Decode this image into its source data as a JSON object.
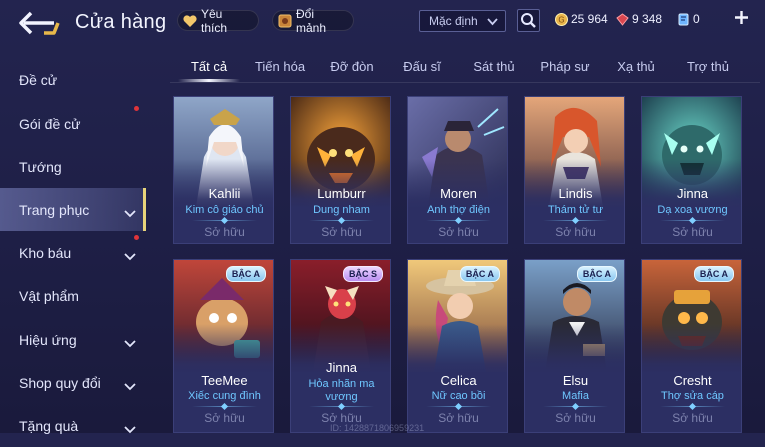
{
  "header": {
    "title": "Cửa hàng",
    "favorite_label": "Yêu thích",
    "trade_label": "Đổi mảnh",
    "sort_value": "Mặc định",
    "currencies": [
      {
        "icon": "gold-coin-icon",
        "value": "25 964"
      },
      {
        "icon": "red-gem-icon",
        "value": "9 348"
      },
      {
        "icon": "ticket-icon",
        "value": "0"
      }
    ]
  },
  "sidebar": {
    "items": [
      {
        "label": "Đề cử"
      },
      {
        "label": "Gói đề cử"
      },
      {
        "label": "Tướng"
      },
      {
        "label": "Trang phục"
      },
      {
        "label": "Kho báu"
      },
      {
        "label": "Vật phẩm"
      },
      {
        "label": "Hiệu ứng"
      },
      {
        "label": "Shop quy đổi"
      },
      {
        "label": "Tặng quà"
      }
    ]
  },
  "tabs": [
    "Tất cả",
    "Tiến hóa",
    "Đỡ đòn",
    "Đấu sĩ",
    "Sát thủ",
    "Pháp sư",
    "Xạ thủ",
    "Trợ thủ"
  ],
  "cards": [
    {
      "name": "Kahlii",
      "skin": "Kim cô giáo chủ",
      "status": "Sở hữu"
    },
    {
      "name": "Lumburr",
      "skin": "Dung nham",
      "status": "Sở hữu"
    },
    {
      "name": "Moren",
      "skin": "Anh thợ điện",
      "status": "Sở hữu"
    },
    {
      "name": "Lindis",
      "skin": "Thám tử tư",
      "status": "Sở hữu"
    },
    {
      "name": "Jinna",
      "skin": "Dạ xoa vương",
      "status": "Sở hữu"
    },
    {
      "name": "TeeMee",
      "skin": "Xiếc cung đình",
      "status": "Sở hữu",
      "badge": "BẬC A"
    },
    {
      "name": "Jinna",
      "skin": "Hỏa nhãn ma vương",
      "status": "Sở hữu",
      "badge": "BẬC S"
    },
    {
      "name": "Celica",
      "skin": "Nữ cao bồi",
      "status": "Sở hữu",
      "badge": "BẬC A"
    },
    {
      "name": "Elsu",
      "skin": "Mafia",
      "status": "Sở hữu",
      "badge": "BẬC A"
    },
    {
      "name": "Cresht",
      "skin": "Thợ sửa cáp",
      "status": "Sở hữu",
      "badge": "BẬC A"
    }
  ],
  "watermark": "ID: 1428871806959231",
  "colors": {
    "accent": "#e8d47a",
    "skin_text": "#6fc7ff",
    "background": "#23244f"
  }
}
